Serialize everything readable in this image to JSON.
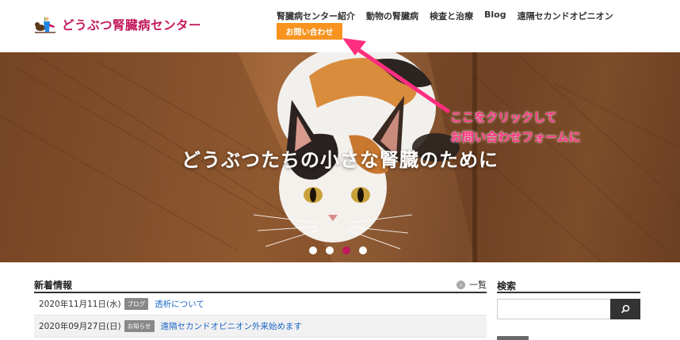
{
  "header": {
    "logo_text": "どうぶつ腎臓病センター",
    "nav": [
      "腎臓病センター紹介",
      "動物の腎臓病",
      "検査と治療",
      "Blog",
      "遠隔セカンドオピニオン"
    ],
    "contact_label": "お問い合わせ"
  },
  "hero": {
    "title": "どうぶつたちの小さな腎臓のために",
    "annotation": [
      "ここをクリックして",
      "お問い合わせフォームに"
    ],
    "slides": 4,
    "active_slide": 3
  },
  "news": {
    "title": "新着情報",
    "more_label": "一覧",
    "items": [
      {
        "date": "2020年11月11日(水)",
        "badge": "ブログ",
        "title": "透析について"
      },
      {
        "date": "2020年09月27日(日)",
        "badge": "お知らせ",
        "title": "遠隔セカンドオピニオン外来始めます"
      }
    ]
  },
  "search": {
    "title": "検索",
    "placeholder": ""
  },
  "colors": {
    "brand": "#c2185b",
    "contact_button": "#f7931e",
    "annotation": "#ff2e7e",
    "link": "#1a66c9"
  },
  "icons": {
    "logo": "pets-logo-icon",
    "more": "chevron-right-circle-icon",
    "search": "search-icon"
  }
}
